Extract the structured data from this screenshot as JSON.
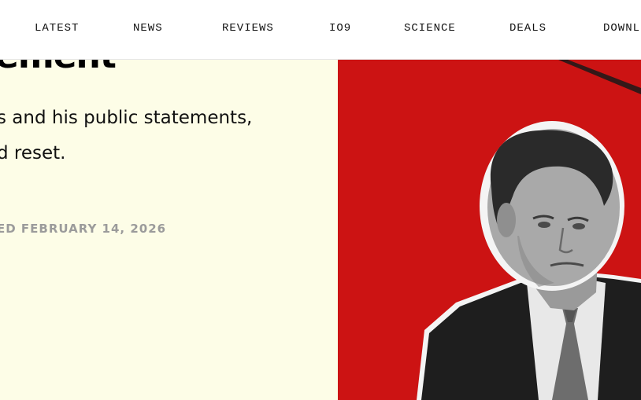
{
  "nav": {
    "items": [
      {
        "label": "LATEST"
      },
      {
        "label": "NEWS"
      },
      {
        "label": "REVIEWS"
      },
      {
        "label": "IO9"
      },
      {
        "label": "SCIENCE"
      },
      {
        "label": "DEALS"
      },
      {
        "label": "DOWNL"
      }
    ]
  },
  "article": {
    "headline_fragment": "ement",
    "dek_lines": [
      "s and his public statements,",
      "d reset."
    ],
    "dateline": "ED FEBRUARY 14, 2026"
  },
  "hero": {
    "background_color": "#cc1313",
    "subject": "portrait-photo"
  },
  "colors": {
    "article_background": "#fdfde7",
    "dateline_text": "#9b9b9b",
    "accent_red": "#cc1313"
  }
}
